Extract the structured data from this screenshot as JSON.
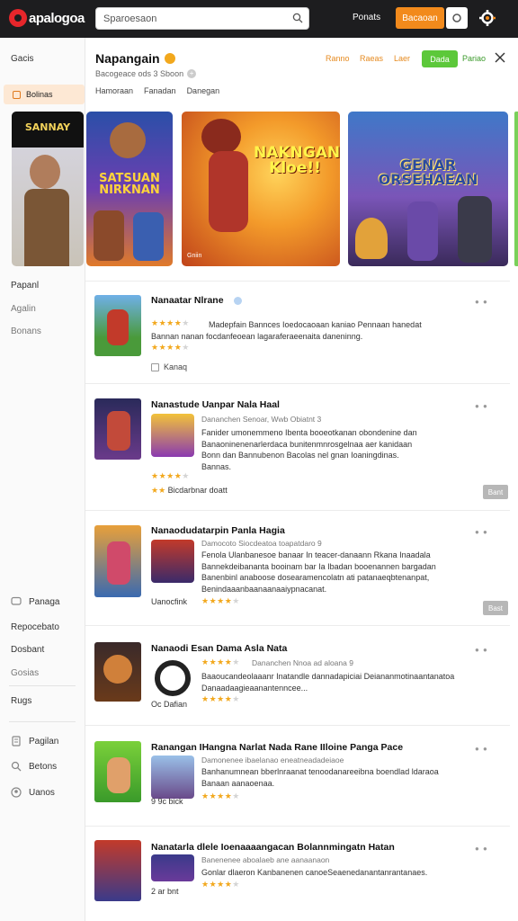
{
  "app": {
    "logo_text": "apalogoa",
    "search_placeholder": "Sparoesaon",
    "top_link": "Ponats",
    "top_button": "Bacaoan",
    "brand_color": "#f28a1c",
    "topbar_color": "#1d1d1f"
  },
  "sidebar": {
    "top_item": "Gacis",
    "active_item": "Bolinas",
    "group1": [
      "Papanl",
      "Agalin",
      "Bonans"
    ],
    "group2": [
      "Panaga",
      "Repocebato",
      "Dosbant",
      "Gosias",
      "Rugs"
    ],
    "group3": [
      {
        "icon": "document-icon",
        "label": "Pagilan"
      },
      {
        "icon": "search-icon",
        "label": "Betons"
      },
      {
        "icon": "user-icon",
        "label": "Uanos"
      }
    ]
  },
  "header": {
    "title": "Napangain",
    "subtitle": "Bacogeace ods 3 Sboon",
    "links": [
      "Ranno",
      "Raeas",
      "Laer"
    ],
    "green_button": "Dada",
    "green_link": "Pariao",
    "tabs": [
      "Hamoraan",
      "Fanadan",
      "Danegan"
    ]
  },
  "banners": [
    {
      "title": "SANNAY",
      "caption": ""
    },
    {
      "title": "SATSUAN NIRKNAN",
      "caption": ""
    },
    {
      "title": "NAKNGAN Kloe!!",
      "caption": "Gniin"
    },
    {
      "title": "GENAR ORSEHAEAN",
      "caption": ""
    }
  ],
  "list": [
    {
      "title": "Nanaatar Nlrane",
      "meta": "",
      "desc": [
        "Madepfain Bannces Ioedocaoaan kaniao Pennaan hanedat",
        "Bannan nanan focdanfeoean lagaraferaeenaita daneninng."
      ],
      "rating": 4,
      "rating2": 4,
      "foot": "Kanaq",
      "chip": ""
    },
    {
      "title": "Nanastude Uanpar Nala Haal",
      "meta": "Dananchen Senoar, Wwb Obiatnt 3",
      "desc": [
        "Fanider umonemmeno Ibenta booeotkanan obondenine dan",
        "Banaoninenenarlerdaca bunitenmnrosgelnaa aer kanidaan",
        "Bonn dan Bannubenon Bacolas nel gnan Ioaningdinas.",
        "Bannas."
      ],
      "rating": 4,
      "rating2": 4,
      "foot": "Bicdarbnar doatt",
      "chip": "Bant"
    },
    {
      "title": "Nanaodudatarpin Panla Hagia",
      "meta": "Damocoto Siocdeatoa toapatdaro 9",
      "desc": [
        "Fenola Ulanbanesoe banaar In teacer-danaann Rkana Inaadala",
        "Bannekdeibananta booinam bar Ia Ibadan booenannen bargadan",
        "Banenbinl anaboose dosearamencolatn ati patanaeqbtenanpat,",
        "Benindaaanbaanaanaaiypnacanat."
      ],
      "rating": 4,
      "rating2": 4,
      "foot": "Uanocfink",
      "chip": "Bast"
    },
    {
      "title": "Nanaodi Esan Dama Asla Nata",
      "meta": "Dananchen Nnoa ad aloana 9",
      "desc": [
        "Baaoucandeolaaanr Inatandle dannadapiciai Deiananmotinaantanatoa",
        "Danaadaagieaanantenncee..."
      ],
      "rating": 4,
      "rating2": 4,
      "foot": "Oc Dafian",
      "chip": ""
    },
    {
      "title": "Ranangan IHangna Narlat Nada Rane IIloine Panga Pace",
      "meta": "Damonenee ibaelanao eneatneadadeiaoe",
      "desc": [
        "Banhanumnean bberlnraanat tenoodanareeibna boendlad ldaraoa",
        "Banaan aanaoenaa."
      ],
      "rating": 4,
      "rating2": 4,
      "foot": "9 9c bick",
      "chip": ""
    },
    {
      "title": "Nanatarla dlele Ioenaaaangacan Bolannmingatn Hatan",
      "meta": "Banenenee aboalaeb ane aanaanaon",
      "desc": [
        "Gonlar dlaeron Kanbanenen canoeSeaenedanantanrantanaes."
      ],
      "rating": 4,
      "rating2": 4,
      "foot": "2 ar bnt",
      "chip": ""
    }
  ]
}
